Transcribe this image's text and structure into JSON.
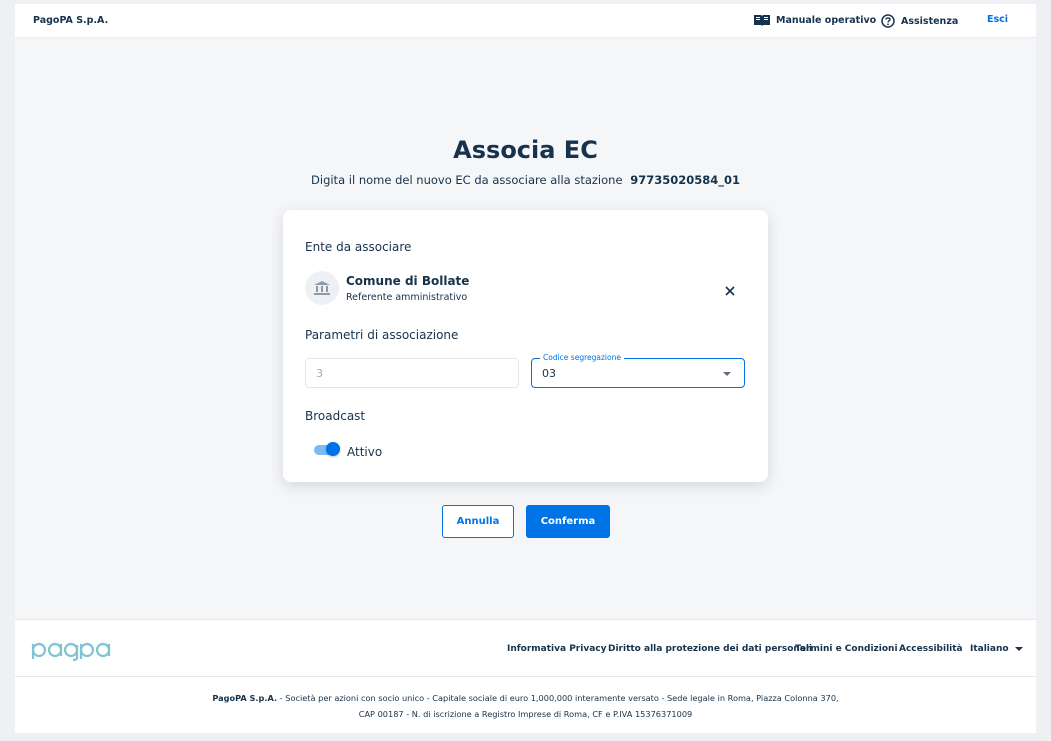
{
  "header": {
    "brand": "PagoPA S.p.A.",
    "manuale_label": "Manuale operativo",
    "assistenza_label": "Assistenza",
    "esci_label": "Esci"
  },
  "page": {
    "title": "Associa EC",
    "subtitle": "Digita il nome del nuovo EC da associare alla stazione",
    "station_code": "97735020584_01"
  },
  "card": {
    "ente_section": "Ente da associare",
    "entity": {
      "name": "Comune di Bollate",
      "role": "Referente amministrativo",
      "icon": "institution-icon"
    },
    "params_section": "Parametri di associazione",
    "aux_digit_value": "3",
    "codice_segregazione": {
      "label": "Codice segregazione",
      "value": "03"
    },
    "broadcast_section": "Broadcast",
    "broadcast_toggle": {
      "label": "Attivo",
      "on": true
    }
  },
  "actions": {
    "cancel_label": "Annulla",
    "confirm_label": "Conferma"
  },
  "footer": {
    "logo": "pagopa",
    "links": [
      "Informativa Privacy",
      "Diritto alla protezione dei dati personali",
      "Termini e Condizioni",
      "Accessibilità"
    ],
    "language": "Italiano",
    "legal_company": "PagoPA S.p.A.",
    "legal_line1": " - Società per azioni con socio unico - Capitale sociale di euro 1,000,000 interamente versato - Sede legale in Roma, Piazza Colonna 370,",
    "legal_line2": "CAP 00187 - N. di iscrizione a Registro Imprese di Roma, CF e P.IVA 15376371009"
  },
  "colors": {
    "primary": "#0073e6",
    "text": "#17324d",
    "background": "#f5f6f8"
  }
}
